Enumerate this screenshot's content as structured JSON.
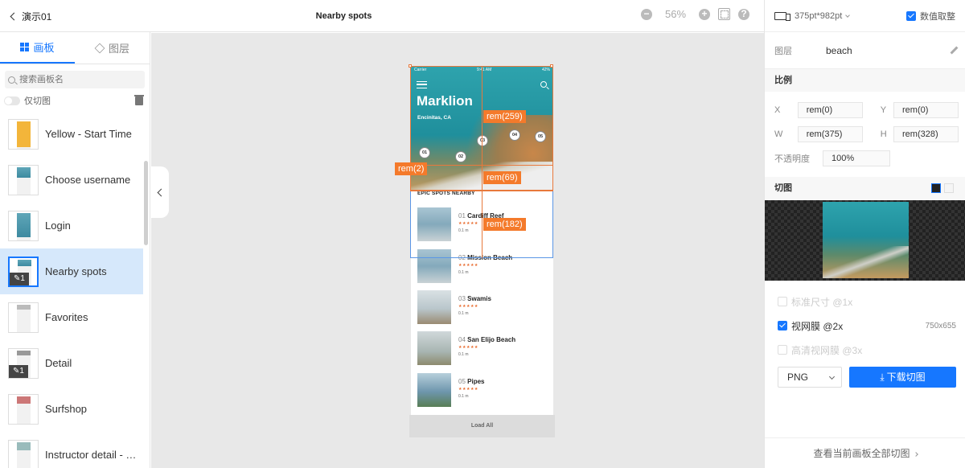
{
  "topbar": {
    "back_label": "演示01",
    "page_title": "Nearby spots",
    "zoom_out": "−",
    "zoom_in": "+",
    "zoom_value": "56%",
    "help": "?"
  },
  "left_panel": {
    "tabs": [
      {
        "label": "画板",
        "icon": "artboard-grid-icon",
        "active": true
      },
      {
        "label": "图层",
        "icon": "layers-icon",
        "active": false
      }
    ],
    "search_placeholder": "搜索画板名",
    "slice_only_label": "仅切图",
    "artboards": [
      {
        "name": "Yellow - Start Time",
        "badge": ""
      },
      {
        "name": "Choose username",
        "badge": ""
      },
      {
        "name": "Login",
        "badge": ""
      },
      {
        "name": "Nearby spots",
        "badge": "1",
        "selected": true
      },
      {
        "name": "Favorites",
        "badge": ""
      },
      {
        "name": "Detail",
        "badge": "1"
      },
      {
        "name": "Surfshop",
        "badge": ""
      },
      {
        "name": "Instructor detail - …",
        "badge": ""
      }
    ]
  },
  "canvas": {
    "status_left": "Carrier",
    "status_time": "9:41 AM",
    "status_right": "42%",
    "app_name": "Marklion",
    "location": "Encinitas, CA",
    "pins": [
      "01",
      "02",
      "03",
      "04",
      "05"
    ],
    "section_heading": "EPIC SPOTS NEARBY",
    "spots": [
      {
        "num": "01",
        "name": "Cardiff Reef",
        "stars": "★★★★★",
        "dist": "0.1 m"
      },
      {
        "num": "02",
        "name": "Mission Beach",
        "stars": "★★★★★",
        "dist": "0.1 m"
      },
      {
        "num": "03",
        "name": "Swamis",
        "stars": "★★★★★",
        "dist": "0.1 m"
      },
      {
        "num": "04",
        "name": "San Elijo Beach",
        "stars": "★★★★★",
        "dist": "0.1 m"
      },
      {
        "num": "05",
        "name": "Pipes",
        "stars": "★★★★★",
        "dist": "0.1 m"
      }
    ],
    "load_all": "Load All",
    "measures": {
      "top": "rem(259)",
      "left": "rem(2)",
      "gap": "rem(69)",
      "right": "rem(182)"
    }
  },
  "right_panel": {
    "device_size": "375pt*982pt",
    "precise_label": "数值取整",
    "layer_label": "图层",
    "layer_name": "beach",
    "scale_title": "比例",
    "fields": {
      "x_label": "X",
      "x_value": "rem(0)",
      "y_label": "Y",
      "y_value": "rem(0)",
      "w_label": "W",
      "w_value": "rem(375)",
      "h_label": "H",
      "h_value": "rem(328)",
      "opacity_label": "不透明度",
      "opacity_value": "100%"
    },
    "slice_title": "切图",
    "scales": [
      {
        "label": "标准尺寸 @1x",
        "checked": false,
        "dim": ""
      },
      {
        "label": "视网膜 @2x",
        "checked": true,
        "dim": "750x655"
      },
      {
        "label": "高清视网膜 @3x",
        "checked": false,
        "dim": ""
      }
    ],
    "format": "PNG",
    "download_label": "下载切图",
    "footer_link": "查看当前画板全部切图"
  },
  "colors": {
    "accent": "#1677ff",
    "measure": "#f47a2b",
    "selected_row": "#d6e8fb"
  }
}
